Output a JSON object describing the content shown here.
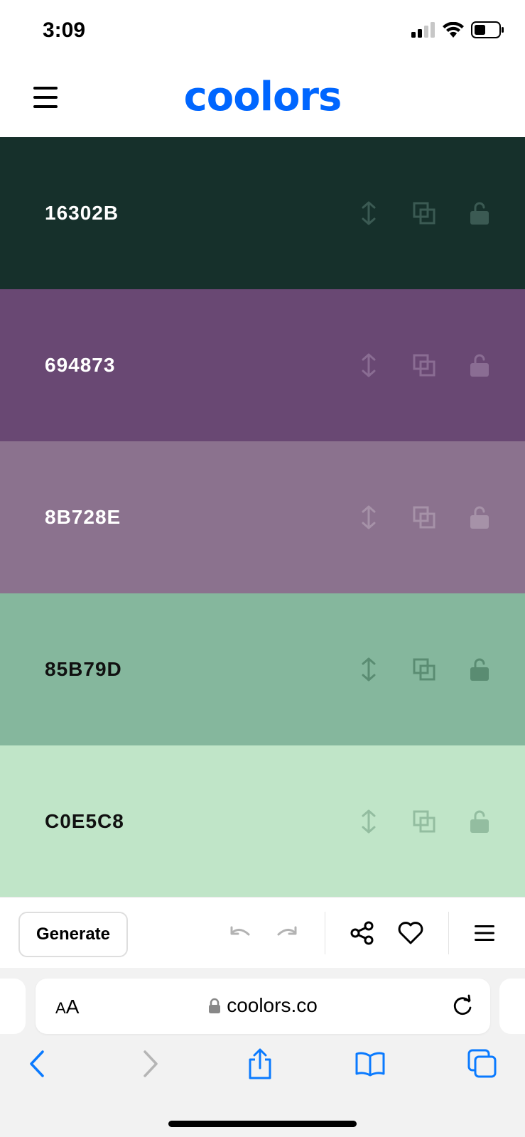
{
  "status_bar": {
    "time": "3:09"
  },
  "header": {
    "logo": "coolors"
  },
  "palette": [
    {
      "hex": "16302B",
      "bg": "#16302B",
      "text_color": "#ffffff",
      "icon_color": "#3b5a53"
    },
    {
      "hex": "694873",
      "bg": "#694873",
      "text_color": "#ffffff",
      "icon_color": "#8a6d93"
    },
    {
      "hex": "8B728E",
      "bg": "#8B728E",
      "text_color": "#ffffff",
      "icon_color": "#a692a8"
    },
    {
      "hex": "85B79D",
      "bg": "#85B79D",
      "text_color": "#111111",
      "icon_color": "#5a8c72"
    },
    {
      "hex": "C0E5C8",
      "bg": "#C0E5C8",
      "text_color": "#111111",
      "icon_color": "#93bda0"
    }
  ],
  "toolbar": {
    "generate_label": "Generate"
  },
  "browser": {
    "aa_small": "A",
    "aa_big": "A",
    "url": "coolors.co",
    "accent": "#0a7aff"
  }
}
